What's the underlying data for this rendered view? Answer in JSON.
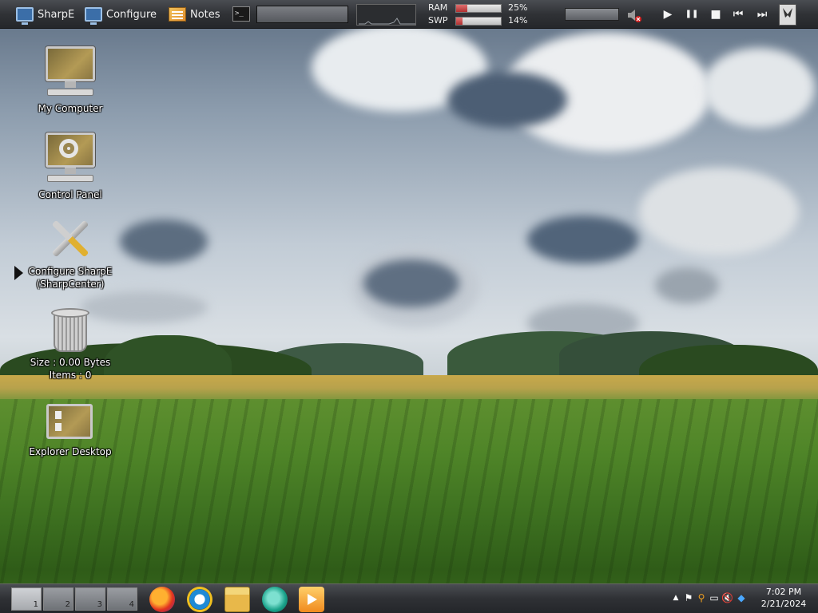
{
  "topbar": {
    "sharpe_label": "SharpE",
    "configure_label": "Configure",
    "notes_label": "Notes",
    "terminal_glyph": ">_",
    "ram_label": "RAM",
    "ram_value": "25%",
    "ram_percent": 25,
    "swap_label": "SWP",
    "swap_value": "14%",
    "swap_percent": 14,
    "media": {
      "play": "▶",
      "pause": "❚❚",
      "stop": "■",
      "prev": "⏮",
      "next": "⏭"
    }
  },
  "desktop": {
    "icons": [
      {
        "label": "My Computer"
      },
      {
        "label": "Control Panel"
      },
      {
        "label": "Configure SharpE\n(SharpCenter)"
      },
      {
        "label": "Size : 0.00 Bytes\nItems : 0"
      },
      {
        "label": "Explorer Desktop"
      }
    ]
  },
  "taskbar": {
    "pagers": [
      "1",
      "2",
      "3",
      "4"
    ],
    "active_pager": "1",
    "apps": [
      "firefox-icon",
      "internet-explorer-icon",
      "file-explorer-icon",
      "sharpe-icon",
      "media-player-icon"
    ],
    "clock_time": "7:02 PM",
    "clock_date": "2/21/2024"
  },
  "colors": {
    "bar_dark": "#303236",
    "meter_fill": "#b03030",
    "icon_gold": "#b39a55"
  }
}
